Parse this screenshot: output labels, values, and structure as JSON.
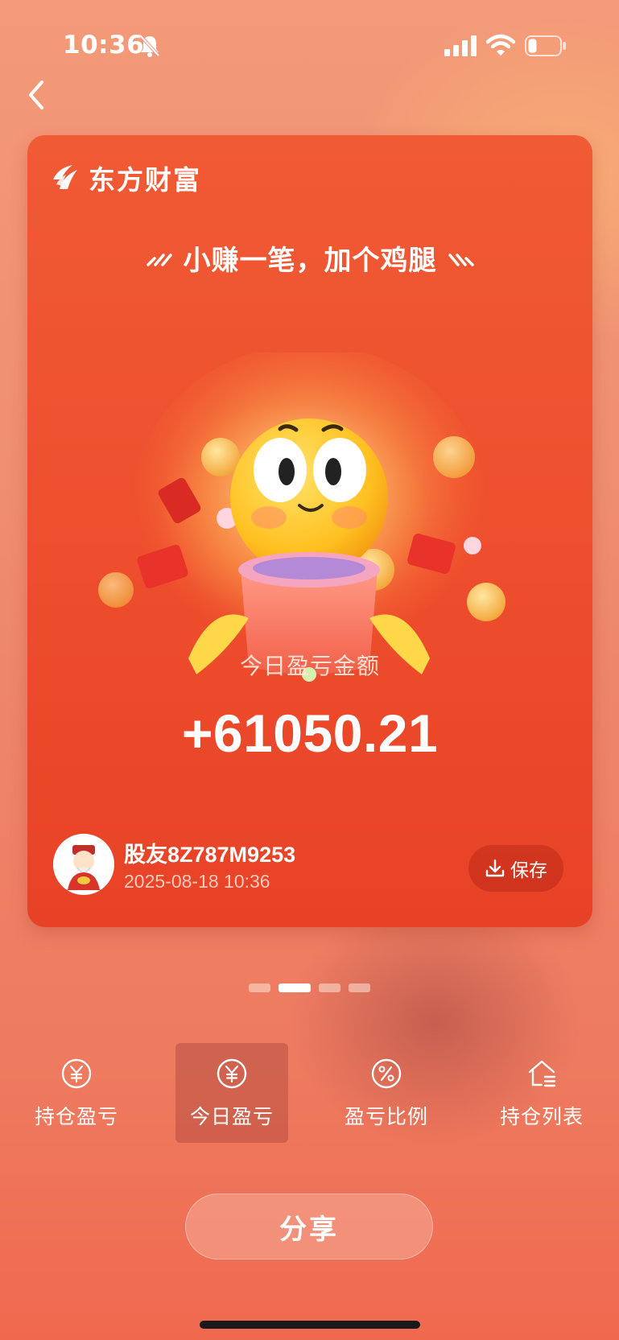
{
  "status_bar": {
    "time": "10:36",
    "icons": [
      "bell-off-icon",
      "signal-icon",
      "wifi-icon",
      "battery-icon"
    ]
  },
  "nav": {
    "back_icon": "chevron-left-icon"
  },
  "card": {
    "brand": "东方财富",
    "slogan": "小赚一笔，加个鸡腿",
    "pl_label": "今日盈亏金额",
    "pl_amount": "+61050.21",
    "user_name": "股友8Z787M9253",
    "timestamp": "2025-08-18 10:36",
    "save_label": "保存"
  },
  "pager": {
    "count": 4,
    "active_index": 1
  },
  "tabs": [
    {
      "label": "持仓盈亏",
      "icon": "yen-circle-icon"
    },
    {
      "label": "今日盈亏",
      "icon": "yen-circle-icon",
      "selected": true
    },
    {
      "label": "盈亏比例",
      "icon": "percent-circle-icon"
    },
    {
      "label": "持仓列表",
      "icon": "house-list-icon"
    }
  ],
  "share_label": "分享",
  "colors": {
    "card_red": "#ee4f2e",
    "background": "#ef8f70",
    "text": "#ffffff"
  }
}
